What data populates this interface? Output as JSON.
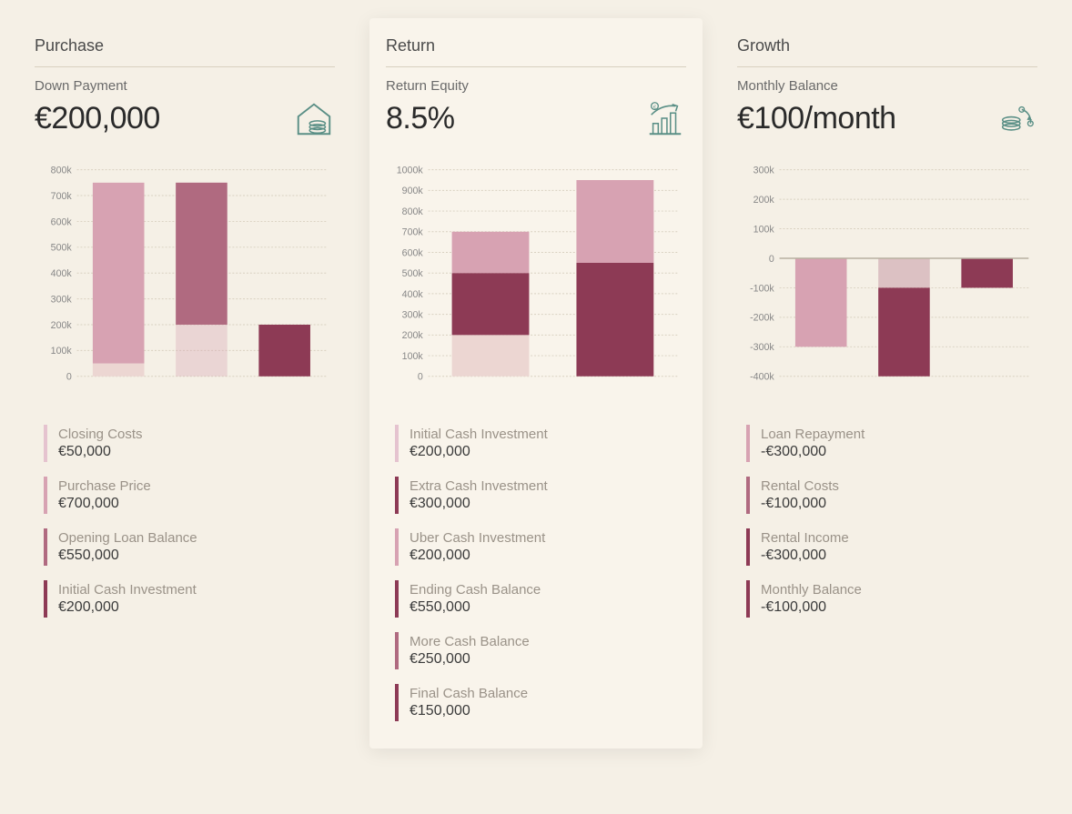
{
  "panels": [
    {
      "id": "purchase",
      "title": "Purchase",
      "metric_label": "Down Payment",
      "metric_value": "€200,000",
      "icon": "house-coins",
      "elevated": false,
      "legend": [
        {
          "label": "Closing Costs",
          "value": "€50,000",
          "color": "#e5c3cf"
        },
        {
          "label": "Purchase Price",
          "value": "€700,000",
          "color": "#d7a2b2"
        },
        {
          "label": "Opening Loan Balance",
          "value": "€550,000",
          "color": "#b06a80"
        },
        {
          "label": "Initial Cash Investment",
          "value": "€200,000",
          "color": "#8d3a55"
        }
      ]
    },
    {
      "id": "return",
      "title": "Return",
      "metric_label": "Return Equity",
      "metric_value": "8.5%",
      "icon": "growth-chart",
      "elevated": true,
      "legend": [
        {
          "label": "Initial Cash Investment",
          "value": "€200,000",
          "color": "#e5c3cf"
        },
        {
          "label": "Extra Cash Investment",
          "value": "€300,000",
          "color": "#8d3a55"
        },
        {
          "label": "Uber Cash Investment",
          "value": "€200,000",
          "color": "#d7a2b2"
        },
        {
          "label": "Ending Cash Balance",
          "value": "€550,000",
          "color": "#8d3a55"
        },
        {
          "label": "More Cash Balance",
          "value": "€250,000",
          "color": "#b06a80"
        },
        {
          "label": "Final Cash Balance",
          "value": "€150,000",
          "color": "#8d3a55"
        }
      ]
    },
    {
      "id": "growth",
      "title": "Growth",
      "metric_label": "Monthly Balance",
      "metric_value": "€100/month",
      "icon": "coins-cycle",
      "elevated": false,
      "legend": [
        {
          "label": "Loan Repayment",
          "value": "-€300,000",
          "color": "#d7a2b2"
        },
        {
          "label": "Rental Costs",
          "value": "-€100,000",
          "color": "#b06a80"
        },
        {
          "label": "Rental Income",
          "value": "-€300,000",
          "color": "#8d3a55"
        },
        {
          "label": "Monthly Balance",
          "value": "-€100,000",
          "color": "#8d3a55"
        }
      ]
    }
  ],
  "chart_data": [
    {
      "panel": "purchase",
      "type": "bar",
      "ylabel": "",
      "ylim": [
        0,
        800000
      ],
      "ticks": [
        "0",
        "100k",
        "200k",
        "300k",
        "400k",
        "500k",
        "600k",
        "700k",
        "800k"
      ],
      "stacks": [
        {
          "segments": [
            {
              "from": 0,
              "to": 50000,
              "color": "#ecd6d2"
            },
            {
              "from": 50000,
              "to": 750000,
              "color": "#d7a2b2"
            }
          ]
        },
        {
          "segments": [
            {
              "from": 0,
              "to": 750000,
              "color": "rgba(215,162,178,0.35)",
              "ghost": true
            },
            {
              "from": 200000,
              "to": 750000,
              "color": "#b06a80"
            }
          ]
        },
        {
          "segments": [
            {
              "from": 0,
              "to": 200000,
              "color": "rgba(141,58,85,0.25)",
              "ghost": true
            },
            {
              "from": 0,
              "to": 200000,
              "color": "#8d3a55"
            }
          ]
        }
      ]
    },
    {
      "panel": "return",
      "type": "bar",
      "ylabel": "",
      "ylim": [
        0,
        1000000
      ],
      "ticks": [
        "0",
        "100k",
        "200k",
        "300k",
        "400k",
        "500k",
        "600k",
        "700k",
        "800k",
        "900k",
        "1000k"
      ],
      "stacks": [
        {
          "segments": [
            {
              "from": 0,
              "to": 200000,
              "color": "#ecd6d2"
            },
            {
              "from": 200000,
              "to": 500000,
              "color": "#8d3a55"
            },
            {
              "from": 500000,
              "to": 700000,
              "color": "#d7a2b2"
            }
          ]
        },
        {
          "segments": [
            {
              "from": 0,
              "to": 550000,
              "color": "#8d3a55"
            },
            {
              "from": 550000,
              "to": 800000,
              "color": "rgba(176,106,128,0.35)",
              "ghost": true
            },
            {
              "from": 550000,
              "to": 950000,
              "color": "#d7a2b2"
            }
          ]
        }
      ]
    },
    {
      "panel": "growth",
      "type": "bar",
      "ylabel": "",
      "ylim": [
        -400000,
        300000
      ],
      "ticks": [
        "-400k",
        "-300k",
        "-200k",
        "-100k",
        "0",
        "100k",
        "200k",
        "300k"
      ],
      "zero": 0,
      "stacks": [
        {
          "segments": [
            {
              "from": -300000,
              "to": 0,
              "color": "#d7a2b2"
            }
          ]
        },
        {
          "segments": [
            {
              "from": -400000,
              "to": -100000,
              "color": "#8d3a55"
            },
            {
              "from": -100000,
              "to": 0,
              "color": "rgba(176,106,128,0.35)",
              "ghost": true
            }
          ]
        },
        {
          "segments": [
            {
              "from": -100000,
              "to": 0,
              "color": "#8d3a55"
            }
          ]
        }
      ]
    }
  ]
}
